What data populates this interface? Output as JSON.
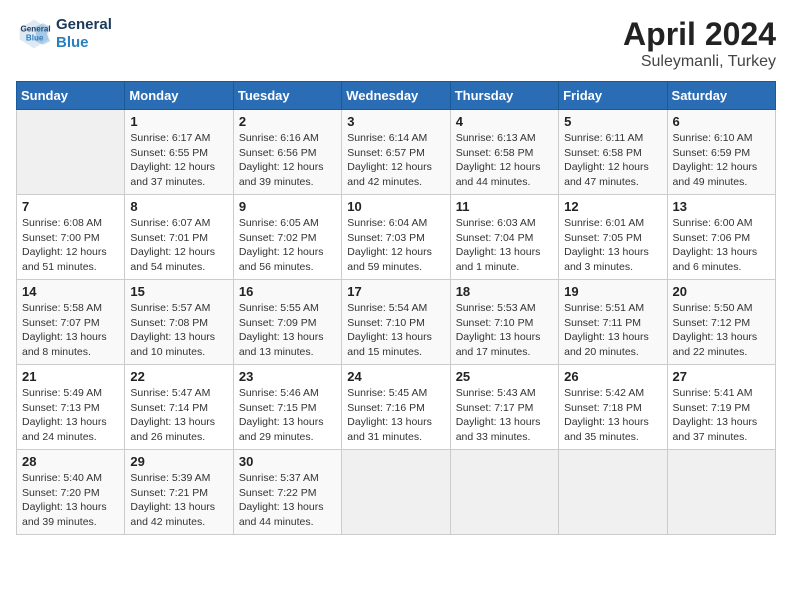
{
  "header": {
    "logo_line1": "General",
    "logo_line2": "Blue",
    "month_year": "April 2024",
    "location": "Suleymanli, Turkey"
  },
  "days_of_week": [
    "Sunday",
    "Monday",
    "Tuesday",
    "Wednesday",
    "Thursday",
    "Friday",
    "Saturday"
  ],
  "weeks": [
    [
      {
        "day": "",
        "info": ""
      },
      {
        "day": "1",
        "info": "Sunrise: 6:17 AM\nSunset: 6:55 PM\nDaylight: 12 hours\nand 37 minutes."
      },
      {
        "day": "2",
        "info": "Sunrise: 6:16 AM\nSunset: 6:56 PM\nDaylight: 12 hours\nand 39 minutes."
      },
      {
        "day": "3",
        "info": "Sunrise: 6:14 AM\nSunset: 6:57 PM\nDaylight: 12 hours\nand 42 minutes."
      },
      {
        "day": "4",
        "info": "Sunrise: 6:13 AM\nSunset: 6:58 PM\nDaylight: 12 hours\nand 44 minutes."
      },
      {
        "day": "5",
        "info": "Sunrise: 6:11 AM\nSunset: 6:58 PM\nDaylight: 12 hours\nand 47 minutes."
      },
      {
        "day": "6",
        "info": "Sunrise: 6:10 AM\nSunset: 6:59 PM\nDaylight: 12 hours\nand 49 minutes."
      }
    ],
    [
      {
        "day": "7",
        "info": "Sunrise: 6:08 AM\nSunset: 7:00 PM\nDaylight: 12 hours\nand 51 minutes."
      },
      {
        "day": "8",
        "info": "Sunrise: 6:07 AM\nSunset: 7:01 PM\nDaylight: 12 hours\nand 54 minutes."
      },
      {
        "day": "9",
        "info": "Sunrise: 6:05 AM\nSunset: 7:02 PM\nDaylight: 12 hours\nand 56 minutes."
      },
      {
        "day": "10",
        "info": "Sunrise: 6:04 AM\nSunset: 7:03 PM\nDaylight: 12 hours\nand 59 minutes."
      },
      {
        "day": "11",
        "info": "Sunrise: 6:03 AM\nSunset: 7:04 PM\nDaylight: 13 hours\nand 1 minute."
      },
      {
        "day": "12",
        "info": "Sunrise: 6:01 AM\nSunset: 7:05 PM\nDaylight: 13 hours\nand 3 minutes."
      },
      {
        "day": "13",
        "info": "Sunrise: 6:00 AM\nSunset: 7:06 PM\nDaylight: 13 hours\nand 6 minutes."
      }
    ],
    [
      {
        "day": "14",
        "info": "Sunrise: 5:58 AM\nSunset: 7:07 PM\nDaylight: 13 hours\nand 8 minutes."
      },
      {
        "day": "15",
        "info": "Sunrise: 5:57 AM\nSunset: 7:08 PM\nDaylight: 13 hours\nand 10 minutes."
      },
      {
        "day": "16",
        "info": "Sunrise: 5:55 AM\nSunset: 7:09 PM\nDaylight: 13 hours\nand 13 minutes."
      },
      {
        "day": "17",
        "info": "Sunrise: 5:54 AM\nSunset: 7:10 PM\nDaylight: 13 hours\nand 15 minutes."
      },
      {
        "day": "18",
        "info": "Sunrise: 5:53 AM\nSunset: 7:10 PM\nDaylight: 13 hours\nand 17 minutes."
      },
      {
        "day": "19",
        "info": "Sunrise: 5:51 AM\nSunset: 7:11 PM\nDaylight: 13 hours\nand 20 minutes."
      },
      {
        "day": "20",
        "info": "Sunrise: 5:50 AM\nSunset: 7:12 PM\nDaylight: 13 hours\nand 22 minutes."
      }
    ],
    [
      {
        "day": "21",
        "info": "Sunrise: 5:49 AM\nSunset: 7:13 PM\nDaylight: 13 hours\nand 24 minutes."
      },
      {
        "day": "22",
        "info": "Sunrise: 5:47 AM\nSunset: 7:14 PM\nDaylight: 13 hours\nand 26 minutes."
      },
      {
        "day": "23",
        "info": "Sunrise: 5:46 AM\nSunset: 7:15 PM\nDaylight: 13 hours\nand 29 minutes."
      },
      {
        "day": "24",
        "info": "Sunrise: 5:45 AM\nSunset: 7:16 PM\nDaylight: 13 hours\nand 31 minutes."
      },
      {
        "day": "25",
        "info": "Sunrise: 5:43 AM\nSunset: 7:17 PM\nDaylight: 13 hours\nand 33 minutes."
      },
      {
        "day": "26",
        "info": "Sunrise: 5:42 AM\nSunset: 7:18 PM\nDaylight: 13 hours\nand 35 minutes."
      },
      {
        "day": "27",
        "info": "Sunrise: 5:41 AM\nSunset: 7:19 PM\nDaylight: 13 hours\nand 37 minutes."
      }
    ],
    [
      {
        "day": "28",
        "info": "Sunrise: 5:40 AM\nSunset: 7:20 PM\nDaylight: 13 hours\nand 39 minutes."
      },
      {
        "day": "29",
        "info": "Sunrise: 5:39 AM\nSunset: 7:21 PM\nDaylight: 13 hours\nand 42 minutes."
      },
      {
        "day": "30",
        "info": "Sunrise: 5:37 AM\nSunset: 7:22 PM\nDaylight: 13 hours\nand 44 minutes."
      },
      {
        "day": "",
        "info": ""
      },
      {
        "day": "",
        "info": ""
      },
      {
        "day": "",
        "info": ""
      },
      {
        "day": "",
        "info": ""
      }
    ]
  ]
}
